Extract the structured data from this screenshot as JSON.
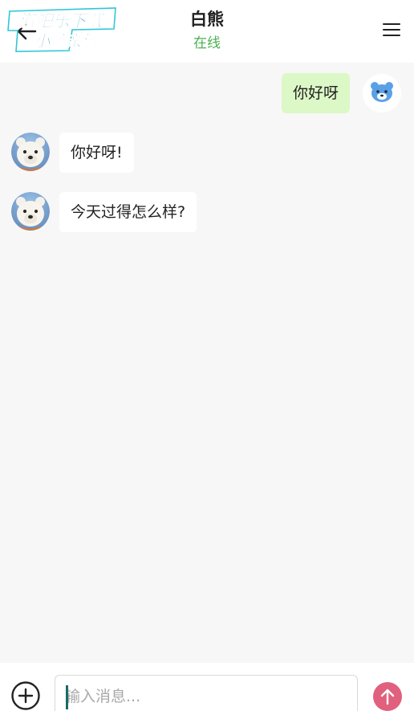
{
  "header": {
    "title": "白熊",
    "status": "在线",
    "back_icon": "arrow-left-icon",
    "menu_icon": "hamburger-menu-icon",
    "watermark": {
      "line1": "游吧乐下载",
      "line2": "小编亲测"
    }
  },
  "messages": [
    {
      "from": "user",
      "text": "你好呀"
    },
    {
      "from": "bot",
      "text": "你好呀!"
    },
    {
      "from": "bot",
      "text": "今天过得怎么样?"
    }
  ],
  "composer": {
    "placeholder": "输入消息...",
    "value": "",
    "add_icon": "plus-circle-icon",
    "send_icon": "arrow-up-icon"
  },
  "colors": {
    "status_green": "#4caf50",
    "user_bubble": "#dcf8c6",
    "bot_bubble": "#ffffff",
    "send_button": "#e0607e",
    "background": "#f7f7f7"
  }
}
